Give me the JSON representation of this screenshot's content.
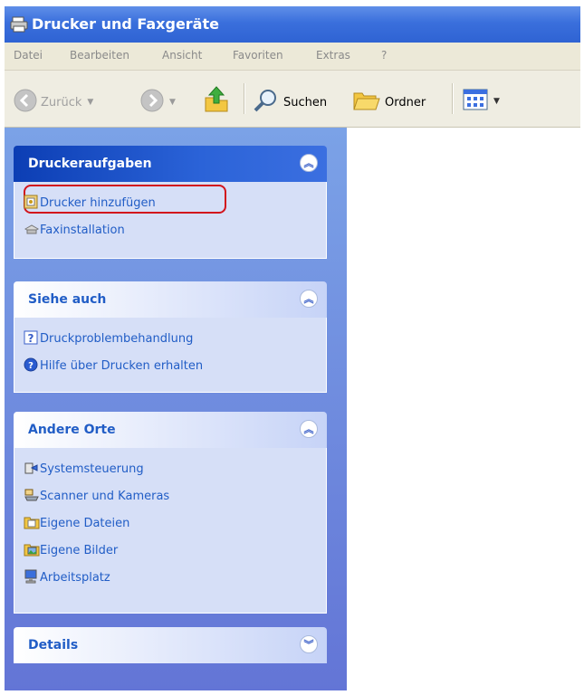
{
  "window": {
    "title": "Drucker und Faxgeräte"
  },
  "menu": [
    "Datei",
    "Bearbeiten",
    "Ansicht",
    "Favoriten",
    "Extras",
    "?"
  ],
  "toolbar": {
    "back": "Zurück",
    "search": "Suchen",
    "folders": "Ordner"
  },
  "panes": {
    "printer_tasks": {
      "title": "Druckeraufgaben",
      "items": [
        "Drucker hinzufügen",
        "Faxinstallation"
      ]
    },
    "see_also": {
      "title": "Siehe auch",
      "items": [
        "Druckproblembehandlung",
        "Hilfe über Drucken erhalten"
      ]
    },
    "other_places": {
      "title": "Andere Orte",
      "items": [
        "Systemsteuerung",
        "Scanner und Kameras",
        "Eigene Dateien",
        "Eigene Bilder",
        "Arbeitsplatz"
      ]
    },
    "details": {
      "title": "Details"
    }
  },
  "colors": {
    "title_bar": "#3a6fdc",
    "task_pane": "#6f8fe0",
    "link": "#215dc6",
    "highlight": "#d2141c"
  }
}
